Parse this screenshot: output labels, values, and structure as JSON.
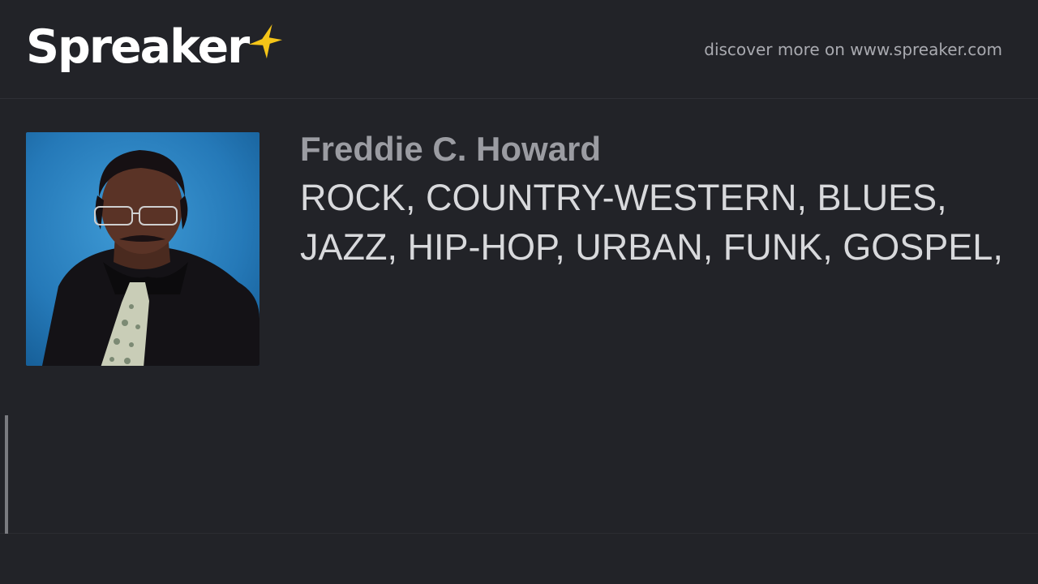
{
  "brand": {
    "logo_text": "Spreaker",
    "star_color": "#f5c518"
  },
  "header": {
    "discover_text": "discover more on www.spreaker.com"
  },
  "episode": {
    "author": "Freddie C. Howard",
    "title": "ROCK, COUNTRY-WESTERN, BLUES, JAZZ, HIP-HOP, URBAN, FUNK, GOSPEL,",
    "cover_image": "author-portrait"
  },
  "player": {
    "progress": 0.0
  }
}
